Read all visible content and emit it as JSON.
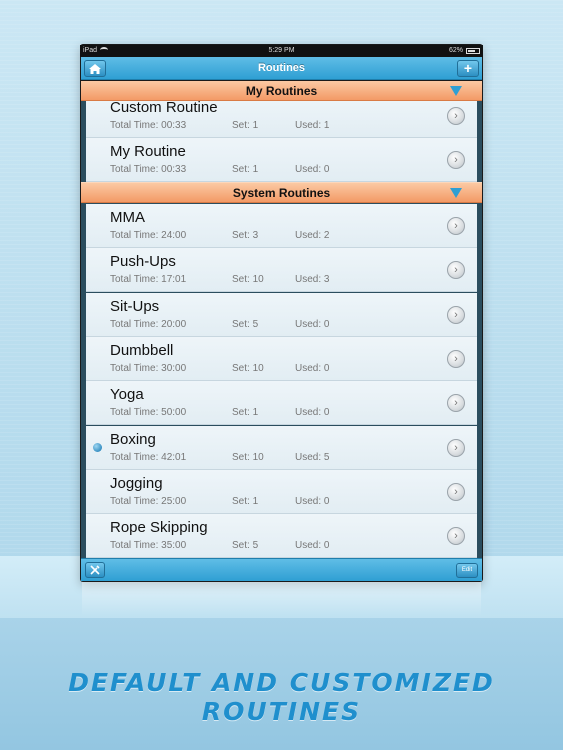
{
  "status_bar": {
    "carrier": "iPad",
    "time": "5:29 PM",
    "battery": "62%"
  },
  "navbar": {
    "title": "Routines",
    "home_icon": "home-icon",
    "add_label": "+"
  },
  "sections": [
    {
      "title": "My Routines",
      "routines": [
        {
          "name": "Custom Routine",
          "total": "Total Time: 00:33",
          "set": "Set: 1",
          "used": "Used: 1"
        },
        {
          "name": "My Routine",
          "total": "Total Time: 00:33",
          "set": "Set: 1",
          "used": "Used: 0"
        }
      ]
    },
    {
      "title": "System Routines",
      "routines": [
        {
          "name": "MMA",
          "total": "Total Time: 24:00",
          "set": "Set: 3",
          "used": "Used: 2"
        },
        {
          "name": "Push-Ups",
          "total": "Total Time: 17:01",
          "set": "Set: 10",
          "used": "Used: 3"
        },
        {
          "name": "Sit-Ups",
          "total": "Total Time: 20:00",
          "set": "Set: 5",
          "used": "Used: 0"
        },
        {
          "name": "Dumbbell",
          "total": "Total Time: 30:00",
          "set": "Set: 10",
          "used": "Used: 0"
        },
        {
          "name": "Yoga",
          "total": "Total Time: 50:00",
          "set": "Set: 1",
          "used": "Used: 0"
        },
        {
          "name": "Boxing",
          "total": "Total Time: 42:01",
          "set": "Set: 10",
          "used": "Used: 5",
          "selected": true
        },
        {
          "name": "Jogging",
          "total": "Total Time: 25:00",
          "set": "Set: 1",
          "used": "Used: 0"
        },
        {
          "name": "Rope Skipping",
          "total": "Total Time: 35:00",
          "set": "Set: 5",
          "used": "Used: 0"
        }
      ]
    }
  ],
  "toolbar": {
    "tools_icon": "tools-icon",
    "edit_label": "Edit"
  },
  "tagline": "Default and customized routines",
  "colors": {
    "navbar": "#2f9fd3",
    "section_header": "#f39a66",
    "tagline": "#1f8fcd"
  }
}
